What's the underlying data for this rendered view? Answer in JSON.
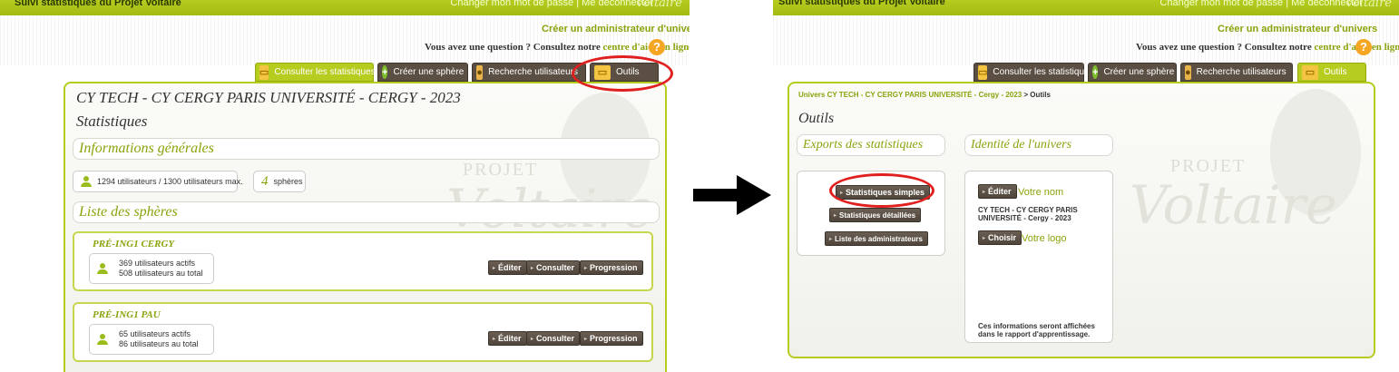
{
  "header": {
    "app_title": "Suivi statistiques du Projet Voltaire",
    "account_links": "Changer mon mot de passe |  Me déconnecter",
    "logo_text": "Voltaire"
  },
  "admin_link": "Créer un administrateur d'univers",
  "help": {
    "prefix": "Vous avez une question ? Consultez notre ",
    "link": "centre d'aide en ligne",
    "icon_glyph": "?"
  },
  "tabs": [
    {
      "label": "Consulter les statistiques",
      "icon": "folder-icon"
    },
    {
      "label": "Créer une sphère",
      "icon": "plus-circle-icon"
    },
    {
      "label": "Recherche utilisateurs",
      "icon": "user-search-icon"
    },
    {
      "label": "Outils",
      "icon": "folder-icon"
    }
  ],
  "left": {
    "active_tab": "Consulter les statistiques",
    "universe_title": "CY TECH - CY CERGY PARIS UNIVERSITÉ - CERGY - 2023",
    "page_title": "Statistiques",
    "general_info_heading": "Informations générales",
    "users_chip": "1294 utilisateurs / 1300 utilisateurs max.",
    "spheres_count": "4",
    "spheres_label": "sphères",
    "spheres_list_heading": "Liste des sphères",
    "spheres": [
      {
        "name": "PRÉ-ING1 CERGY",
        "active": "369 utilisateurs actifs",
        "total": "508 utilisateurs au total"
      },
      {
        "name": "PRÉ-ING1 PAU",
        "active": "65 utilisateurs actifs",
        "total": "86 utilisateurs au total"
      }
    ],
    "buttons": {
      "edit": "Éditer",
      "view": "Consulter",
      "progress": "Progression"
    },
    "watermark_top": "PROJET",
    "watermark_script": "Voltaire"
  },
  "right": {
    "active_tab": "Outils",
    "breadcrumb_link": "Univers CY TECH - CY CERGY PARIS UNIVERSITÉ - Cergy - 2023",
    "breadcrumb_tail": " > Outils",
    "page_title": "Outils",
    "exports_heading": "Exports des statistiques",
    "identity_heading": "Identité de l'univers",
    "export_buttons": [
      "Statistiques simples",
      "Statistiques détaillées",
      "Liste des administrateurs"
    ],
    "edit_button": "Éditer",
    "name_label": "Votre nom",
    "universe_name_line1": "CY TECH - CY CERGY PARIS",
    "universe_name_line2": "UNIVERSITÉ - Cergy - 2023",
    "choose_button": "Choisir",
    "logo_label": "Votre logo",
    "report_note_line1": "Ces informations seront affichées",
    "report_note_line2": "dans le rapport d'apprentissage.",
    "watermark_top": "PROJET",
    "watermark_script": "Voltaire"
  },
  "colors": {
    "brand_green": "#b6cc1f",
    "tab_brown": "#5b4f44",
    "highlight_red": "#e0201f",
    "help_orange": "#f5a623"
  }
}
